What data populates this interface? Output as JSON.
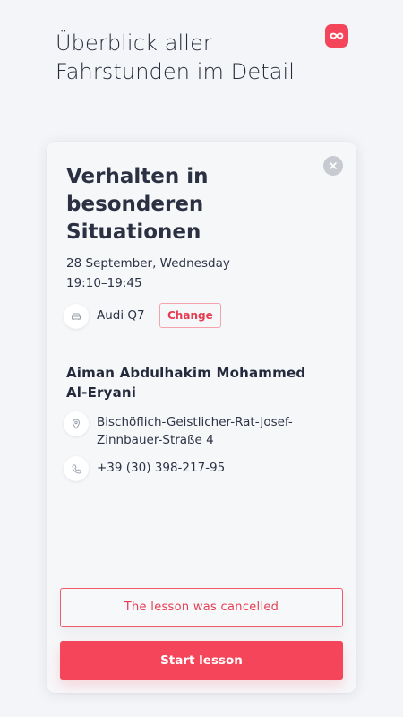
{
  "header": {
    "headline": "Überblick aller Fahrstunden im Detail",
    "logo_icon": "infinity-logo-icon",
    "brand_color": "#f4455a"
  },
  "lesson": {
    "title": "Verhalten in besonderen Situationen",
    "date": "28 September, Wednesday",
    "time": "19:10–19:45",
    "car": "Audi Q7",
    "change_label": "Change"
  },
  "instructor": {
    "name": "Aiman Abdulhakim Mohammed Al-Eryani",
    "address": "Bischöflich-Geistlicher-Rat-Josef-Zinnbauer-Straße 4",
    "phone": "+39 (30) 398-217-95"
  },
  "status": {
    "cancel_notice": "The lesson was cancelled"
  },
  "actions": {
    "start_label": "Start lesson"
  }
}
